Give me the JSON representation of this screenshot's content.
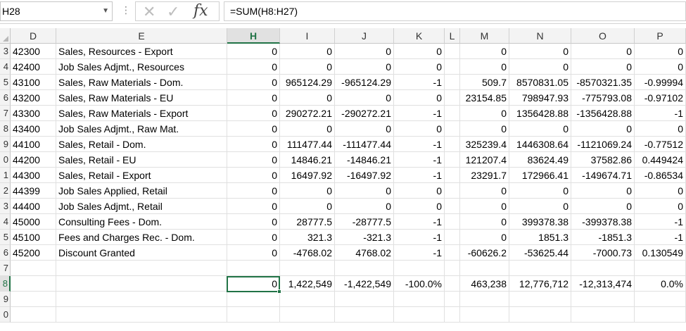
{
  "namebox": {
    "value": "H28"
  },
  "formula_bar": {
    "separator": "⋮",
    "cancel_glyph": "✕",
    "enter_glyph": "✓",
    "fx_glyph": "fx",
    "formula": "=SUM(H8:H27)"
  },
  "columns": [
    "D",
    "E",
    "H",
    "I",
    "J",
    "K",
    "L",
    "M",
    "N",
    "O",
    "P"
  ],
  "selected_column": "H",
  "rows": [
    {
      "rh": "3",
      "D": "42300",
      "E": "Sales, Resources - Export",
      "H": "0",
      "I": "0",
      "J": "0",
      "K": "0",
      "M": "0",
      "N": "0",
      "O": "0",
      "P": "0"
    },
    {
      "rh": "4",
      "D": "42400",
      "E": "Job Sales Adjmt., Resources",
      "H": "0",
      "I": "0",
      "J": "0",
      "K": "0",
      "M": "0",
      "N": "0",
      "O": "0",
      "P": "0"
    },
    {
      "rh": "5",
      "D": "43100",
      "E": "Sales, Raw Materials - Dom.",
      "H": "0",
      "I": "965124.29",
      "J": "-965124.29",
      "K": "-1",
      "M": "509.7",
      "N": "8570831.05",
      "O": "-8570321.35",
      "P": "-0.99994"
    },
    {
      "rh": "6",
      "D": "43200",
      "E": "Sales, Raw Materials - EU",
      "H": "0",
      "I": "0",
      "J": "0",
      "K": "0",
      "M": "23154.85",
      "N": "798947.93",
      "O": "-775793.08",
      "P": "-0.97102"
    },
    {
      "rh": "7",
      "D": "43300",
      "E": "Sales, Raw Materials - Export",
      "H": "0",
      "I": "290272.21",
      "J": "-290272.21",
      "K": "-1",
      "M": "0",
      "N": "1356428.88",
      "O": "-1356428.88",
      "P": "-1"
    },
    {
      "rh": "8",
      "D": "43400",
      "E": "Job Sales Adjmt., Raw Mat.",
      "H": "0",
      "I": "0",
      "J": "0",
      "K": "0",
      "M": "0",
      "N": "0",
      "O": "0",
      "P": "0"
    },
    {
      "rh": "9",
      "D": "44100",
      "E": "Sales, Retail - Dom.",
      "H": "0",
      "I": "111477.44",
      "J": "-111477.44",
      "K": "-1",
      "M": "325239.4",
      "N": "1446308.64",
      "O": "-1121069.24",
      "P": "-0.77512"
    },
    {
      "rh": "0",
      "D": "44200",
      "E": "Sales, Retail - EU",
      "H": "0",
      "I": "14846.21",
      "J": "-14846.21",
      "K": "-1",
      "M": "121207.4",
      "N": "83624.49",
      "O": "37582.86",
      "P": "0.449424"
    },
    {
      "rh": "1",
      "D": "44300",
      "E": "Sales, Retail - Export",
      "H": "0",
      "I": "16497.92",
      "J": "-16497.92",
      "K": "-1",
      "M": "23291.7",
      "N": "172966.41",
      "O": "-149674.71",
      "P": "-0.86534"
    },
    {
      "rh": "2",
      "D": "44399",
      "E": "Job Sales Applied, Retail",
      "H": "0",
      "I": "0",
      "J": "0",
      "K": "0",
      "M": "0",
      "N": "0",
      "O": "0",
      "P": "0"
    },
    {
      "rh": "3",
      "D": "44400",
      "E": "Job Sales Adjmt., Retail",
      "H": "0",
      "I": "0",
      "J": "0",
      "K": "0",
      "M": "0",
      "N": "0",
      "O": "0",
      "P": "0"
    },
    {
      "rh": "4",
      "D": "45000",
      "E": "Consulting Fees - Dom.",
      "H": "0",
      "I": "28777.5",
      "J": "-28777.5",
      "K": "-1",
      "M": "0",
      "N": "399378.38",
      "O": "-399378.38",
      "P": "-1"
    },
    {
      "rh": "5",
      "D": "45100",
      "E": "Fees and Charges Rec. - Dom.",
      "H": "0",
      "I": "321.3",
      "J": "-321.3",
      "K": "-1",
      "M": "0",
      "N": "1851.3",
      "O": "-1851.3",
      "P": "-1"
    },
    {
      "rh": "6",
      "D": "45200",
      "E": "Discount Granted",
      "H": "0",
      "I": "-4768.02",
      "J": "4768.02",
      "K": "-1",
      "M": "-60626.2",
      "N": "-53625.44",
      "O": "-7000.73",
      "P": "0.130549"
    },
    {
      "rh": "7",
      "D": "",
      "E": "",
      "H": "",
      "I": "",
      "J": "",
      "K": "",
      "M": "",
      "N": "",
      "O": "",
      "P": ""
    },
    {
      "rh": "8",
      "D": "",
      "E": "",
      "H": "0",
      "I": "1,422,549",
      "J": "-1,422,549",
      "K": "-100.0%",
      "M": "463,238",
      "N": "12,776,712",
      "O": "-12,313,474",
      "P": "0.0%"
    },
    {
      "rh": "9",
      "D": "",
      "E": "",
      "H": "",
      "I": "",
      "J": "",
      "K": "",
      "M": "",
      "N": "",
      "O": "",
      "P": ""
    },
    {
      "rh": "0",
      "D": "",
      "E": "",
      "H": "",
      "I": "",
      "J": "",
      "K": "",
      "M": "",
      "N": "",
      "O": "",
      "P": ""
    }
  ],
  "selected_row_index": 15,
  "colors": {
    "accent": "#217346",
    "header_bg": "#f3f3f3",
    "gridline": "#e0e0e0"
  }
}
